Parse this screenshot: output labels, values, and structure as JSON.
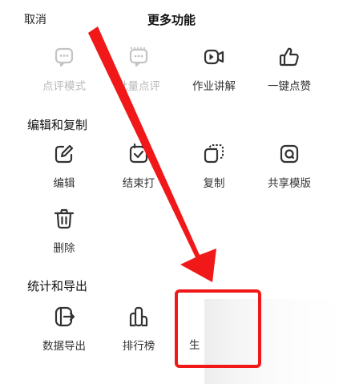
{
  "header": {
    "cancel_label": "取消",
    "title": "更多功能"
  },
  "sections": {
    "top": {
      "items": [
        {
          "label": "点评模式",
          "icon": "comment-mode-icon",
          "enabled": false
        },
        {
          "label": "批量点评",
          "icon": "batch-comment-icon",
          "enabled": false
        },
        {
          "label": "作业讲解",
          "icon": "video-camera-icon",
          "enabled": true
        },
        {
          "label": "一键点赞",
          "icon": "thumbs-up-icon",
          "enabled": true
        }
      ]
    },
    "edit": {
      "title": "编辑和复制",
      "items": [
        {
          "label": "编辑",
          "icon": "edit-pencil-icon"
        },
        {
          "label": "结束打卡",
          "icon": "end-checkin-icon",
          "visible_label": "结束打"
        },
        {
          "label": "复制",
          "icon": "copy-icon"
        },
        {
          "label": "共享模版",
          "icon": "share-template-icon"
        },
        {
          "label": "删除",
          "icon": "trash-icon"
        }
      ]
    },
    "stats": {
      "title": "统计和导出",
      "items": [
        {
          "label": "数据导出",
          "icon": "data-export-icon"
        },
        {
          "label": "排行榜",
          "icon": "ranking-icon"
        },
        {
          "label": "生",
          "icon": "generate-icon"
        }
      ]
    }
  },
  "annotation": {
    "arrow_color": "#f01818",
    "box_color": "#f01818"
  }
}
